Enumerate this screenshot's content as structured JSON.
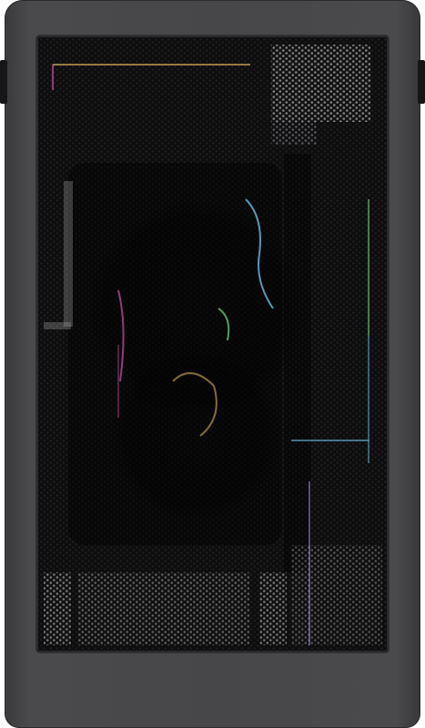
{
  "image": {
    "subject": "pc-case-front-panel",
    "colors": {
      "page_background": "#ffffff",
      "case_body": "#474749",
      "mesh_background": "#0b0b0c",
      "mesh_holes": "#1c1c1e",
      "rgb_accents": [
        "#7fd6ff",
        "#ff6bd6",
        "#ffd36b",
        "#8bff9a",
        "#c89bff"
      ]
    }
  }
}
